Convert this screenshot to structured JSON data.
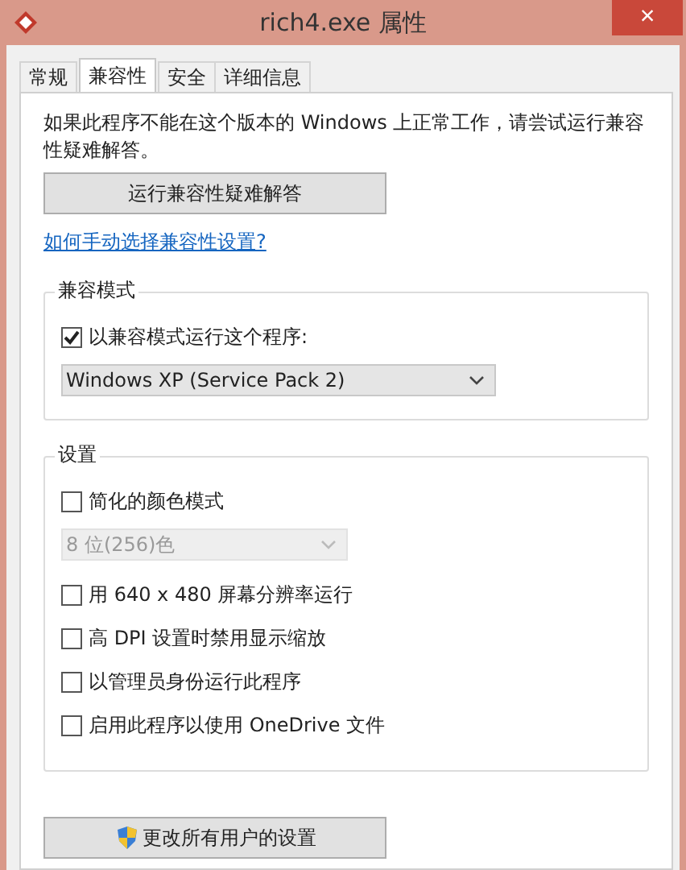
{
  "window": {
    "title": "rich4.exe 属性",
    "close": "×"
  },
  "tabs": [
    {
      "label": "常规",
      "selected": false
    },
    {
      "label": "兼容性",
      "selected": true
    },
    {
      "label": "安全",
      "selected": false
    },
    {
      "label": "详细信息",
      "selected": false
    }
  ],
  "intro": "如果此程序不能在这个版本的 Windows 上正常工作，请尝试运行兼容性疑难解答。",
  "troubleshoot_button": "运行兼容性疑难解答",
  "help_link": "如何手动选择兼容性设置?",
  "groups": [
    {
      "title": "兼容模式",
      "items": [
        {
          "kind": "checkbox",
          "label": "以兼容模式运行这个程序:",
          "checked": true
        },
        {
          "kind": "dropdown",
          "value": "Windows XP (Service Pack 2)",
          "disabled": false
        }
      ]
    },
    {
      "title": "设置",
      "items": [
        {
          "kind": "checkbox",
          "label": "简化的颜色模式",
          "checked": false
        },
        {
          "kind": "dropdown",
          "value": "8 位(256)色",
          "disabled": true
        },
        {
          "kind": "checkbox",
          "label": "用 640 x 480 屏幕分辨率运行",
          "checked": false
        },
        {
          "kind": "checkbox",
          "label": "高 DPI 设置时禁用显示缩放",
          "checked": false
        },
        {
          "kind": "checkbox",
          "label": "以管理员身份运行此程序",
          "checked": false
        },
        {
          "kind": "checkbox",
          "label": "启用此程序以使用 OneDrive 文件",
          "checked": false
        }
      ]
    }
  ],
  "all_users_button": "更改所有用户的设置"
}
